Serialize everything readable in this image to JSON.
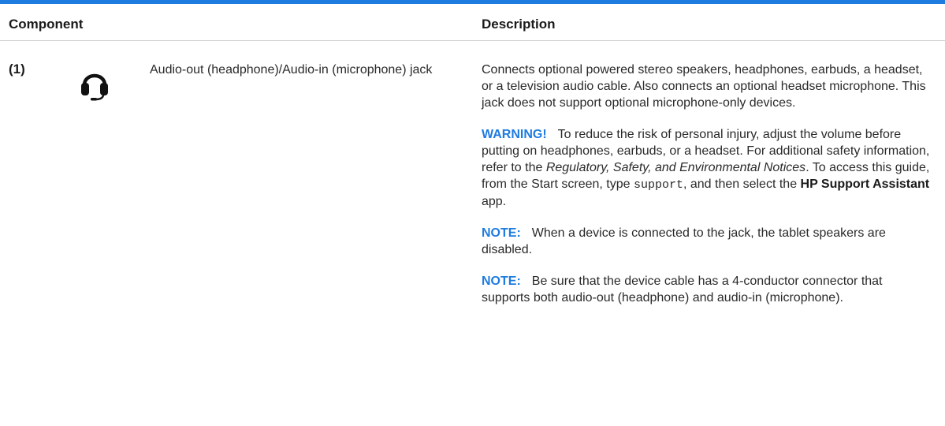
{
  "table": {
    "header": {
      "component": "Component",
      "description": "Description"
    },
    "row": {
      "callout": "(1)",
      "icon": "headset-icon",
      "component_name": "Audio-out (headphone)/Audio-in (microphone) jack",
      "paragraphs": {
        "intro": "Connects optional powered stereo speakers, headphones, earbuds, a headset, or a television audio cable. Also connects an optional headset microphone. This jack does not support optional microphone-only devices.",
        "warning": {
          "label": "WARNING!",
          "text_1": "To reduce the risk of personal injury, adjust the volume before putting on headphones, earbuds, or a headset. For additional safety information, refer to the ",
          "doc_title": "Regulatory, Safety, and Environmental Notices",
          "text_2": ". To access this guide, from the Start screen, type ",
          "command": "support",
          "text_3": ", and then select the ",
          "app_name": "HP Support Assistant",
          "text_4": " app."
        },
        "note_1": {
          "label": "NOTE:",
          "text": "When a device is connected to the jack, the tablet speakers are disabled."
        },
        "note_2": {
          "label": "NOTE:",
          "text": "Be sure that the device cable has a 4-conductor connector that supports both audio-out (headphone) and audio-in (microphone)."
        }
      }
    }
  },
  "colors": {
    "accent": "#1e7be0",
    "text": "#222222",
    "rule": "#cfcfcf"
  }
}
